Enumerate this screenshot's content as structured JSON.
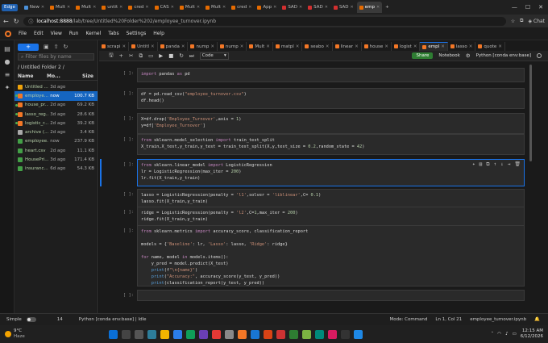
{
  "browser": {
    "edge_label": "Edge",
    "tabs": [
      {
        "label": "New",
        "color": "#4a90d9"
      },
      {
        "label": "Mult",
        "color": "#e66b00"
      },
      {
        "label": "Mult",
        "color": "#e66b00"
      },
      {
        "label": "untit",
        "color": "#e66b00"
      },
      {
        "label": "cred",
        "color": "#e66b00"
      },
      {
        "label": "CAS",
        "color": "#e66b00"
      },
      {
        "label": "Mult",
        "color": "#e66b00"
      },
      {
        "label": "Mult",
        "color": "#e66b00"
      },
      {
        "label": "cred",
        "color": "#e66b00"
      },
      {
        "label": "App",
        "color": "#e66b00"
      },
      {
        "label": "SAD",
        "color": "#d32f2f"
      },
      {
        "label": "SAD",
        "color": "#d32f2f"
      },
      {
        "label": "SAD",
        "color": "#d32f2f"
      },
      {
        "label": "emp",
        "color": "#e66b00"
      }
    ],
    "new_tab": "+",
    "url_host": "localhost:8888",
    "url_path": "/lab/tree/Untitled%20Folder%202/employee_turnover.ipynb",
    "chat_label": "Chat"
  },
  "menu": [
    "File",
    "Edit",
    "View",
    "Run",
    "Kernel",
    "Tabs",
    "Settings",
    "Help"
  ],
  "filebrowser": {
    "new_label": "+",
    "filter_placeholder": "Filter files by name",
    "path": "/ Untitled Folder 2 /",
    "col_name": "Name",
    "col_modified": "Mo...",
    "col_size": "Size",
    "files": [
      {
        "name": "Untitled ...",
        "modified": "3d ago",
        "size": "",
        "type": "folder",
        "running": false,
        "selected": false
      },
      {
        "name": "employe...",
        "modified": "now",
        "size": "100.7 KB",
        "type": "notebook",
        "running": true,
        "selected": true
      },
      {
        "name": "house_pr...",
        "modified": "2d ago",
        "size": "69.2 KB",
        "type": "notebook",
        "running": true,
        "selected": false
      },
      {
        "name": "lasso_reg...",
        "modified": "3d ago",
        "size": "28.6 KB",
        "type": "notebook",
        "running": true,
        "selected": false
      },
      {
        "name": "logistic_r...",
        "modified": "2d ago",
        "size": "39.2 KB",
        "type": "notebook",
        "running": true,
        "selected": false
      },
      {
        "name": "archive (...",
        "modified": "2d ago",
        "size": "3.4 KB",
        "type": "file",
        "running": false,
        "selected": false
      },
      {
        "name": "employee...",
        "modified": "now",
        "size": "237.9 KB",
        "type": "csv",
        "running": false,
        "selected": false
      },
      {
        "name": "heart.csv",
        "modified": "2d ago",
        "size": "11.1 KB",
        "type": "csv",
        "running": false,
        "selected": false
      },
      {
        "name": "HousePri...",
        "modified": "3d ago",
        "size": "171.4 KB",
        "type": "csv",
        "running": false,
        "selected": false
      },
      {
        "name": "insuranc...",
        "modified": "6d ago",
        "size": "54.3 KB",
        "type": "csv",
        "running": false,
        "selected": false
      }
    ]
  },
  "nbtabs": [
    "scrapi",
    "Untitl",
    "panda",
    "nump",
    "nump",
    "Mult",
    "matpl",
    "seabo",
    "linear",
    "house",
    "logist",
    "empl",
    "lasso",
    "quote"
  ],
  "nbtab_active_index": 11,
  "toolbar": {
    "celltype": "Code",
    "share": "Share",
    "notebook": "Notebook",
    "kernel": "Python [conda env:base]"
  },
  "cells": [
    {
      "prompt": "[ ]:",
      "lines": [
        "import pandas as pd"
      ]
    },
    {
      "prompt": "[ ]:",
      "lines": [
        "df = pd.read_csv(\"employee_turnover.csv\")",
        "df.head()"
      ]
    },
    {
      "prompt": "[ ]:",
      "lines": [
        "X=df.drop('Employee_Turnover',axis = 1)",
        "y=df['Employee_Turnover']"
      ]
    },
    {
      "prompt": "[ ]:",
      "lines": [
        "from sklearn.model_selection import train_test_split",
        "X_train,X_test,y_train,y_test = train_test_split(X,y,test_size = 0.2,random_state = 42)"
      ]
    },
    {
      "prompt": "[ ]:",
      "lines": [
        "from sklearn.linear_model import LogisticRegression",
        "lr = LogisticRegression(max_iter = 200)",
        "lr.fit(X_train,y_train)"
      ]
    },
    {
      "prompt": "[ ]:",
      "lines": [
        "lasso = LogisticRegression(penalty = 'l1',solver = 'liblinear',C= 0.1)",
        "lasso.fit(X_train,y_train)"
      ]
    },
    {
      "prompt": "[ ]:",
      "lines": [
        "ridge = LogisticRegression(penalty = 'l2',C=1,max_iter = 200)",
        "ridge.fit(X_train,y_train)"
      ]
    },
    {
      "prompt": "[ ]:",
      "lines": [
        "from sklearn.metrics import accuracy_score, classification_report",
        "",
        "models = {'Baseline': lr, 'Lasso': lasso, 'Ridge': ridge}",
        "",
        "for name, model in models.items():",
        "    y_pred = model.predict(X_test)",
        "    print(f\"\\n{name}\")",
        "    print(\"Accuracy:\", accuracy_score(y_test, y_pred))",
        "    print(classification_report(y_test, y_pred))"
      ]
    },
    {
      "prompt": "[ ]:",
      "lines": [
        ""
      ]
    }
  ],
  "status": {
    "mode_label": "Simple",
    "count": "14",
    "kernel": "Python [conda env:base] | Idle",
    "mode": "Mode: Command",
    "position": "Ln 1, Col 21",
    "file": "employee_turnover.ipynb"
  },
  "taskbar": {
    "temp": "9°C",
    "weather": "Haze",
    "time": "12:15 AM",
    "date": "6/12/2026"
  }
}
